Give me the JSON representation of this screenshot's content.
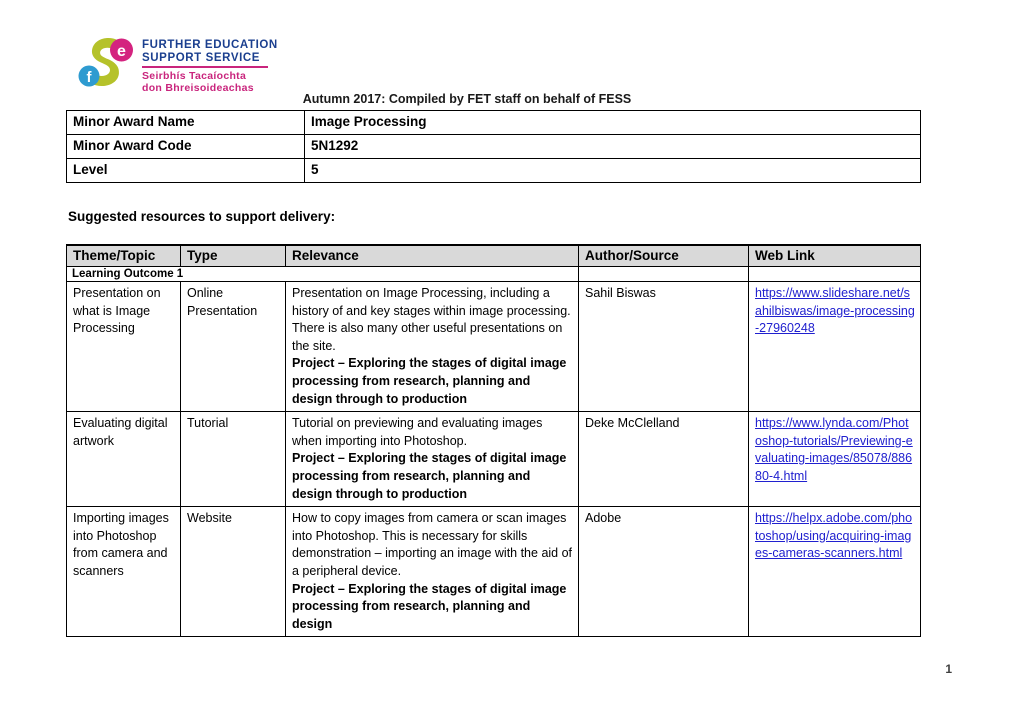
{
  "logo": {
    "alt": "Further Education Support Service",
    "line1": "FURTHER EDUCATION SUPPORT SERVICE",
    "line1_a": "FURTHER EDUCATION",
    "line1_b": "SUPPORT SERVICE",
    "line2_a": "Seirbhís Tacaíochta",
    "line2_b": "don Bhreisoideachas",
    "badge_e": "e",
    "badge_f": "f",
    "colors": {
      "swirl": "#b5c22a",
      "pink": "#d4237f",
      "blue": "#2e9bd0",
      "navy": "#1b3f8f"
    }
  },
  "header": {
    "text": "Autumn 2017: Compiled by FET staff on behalf of FESS"
  },
  "award": {
    "rows": [
      {
        "label": "Minor Award Name",
        "value": "Image Processing"
      },
      {
        "label": "Minor Award Code",
        "value": "5N1292"
      },
      {
        "label": "Level",
        "value": "5"
      }
    ]
  },
  "section": {
    "heading": "Suggested resources to support delivery:"
  },
  "resources": {
    "columns": [
      "Theme/Topic",
      "Type",
      "Relevance",
      "Author/Source",
      "Web Link"
    ],
    "group_label": "Learning Outcome 1",
    "rows": [
      {
        "theme": "Presentation on what is Image Processing",
        "type": "Online Presentation",
        "relevance": "Presentation on Image Processing, including a history of and key stages within image processing. There is also many other useful presentations on the site.",
        "relevance_bold": "Project – Exploring the stages of digital image processing from research, planning and design through to production",
        "author": "Sahil Biswas",
        "weblink": "https://www.slideshare.net/sahilbiswas/image-processing-27960248"
      },
      {
        "theme": "Evaluating digital artwork",
        "type": "Tutorial",
        "relevance": "Tutorial on previewing and evaluating images when importing into Photoshop.",
        "relevance_bold": "Project – Exploring the stages of digital image processing from research, planning and design through to production",
        "author": "Deke McClelland",
        "weblink": "https://www.lynda.com/Photoshop-tutorials/Previewing-evaluating-images/85078/88680-4.html"
      },
      {
        "theme": "Importing images into Photoshop from camera and scanners",
        "type": "Website",
        "relevance": "How to copy images from camera or scan images into Photoshop. This is necessary for skills demonstration – importing an image with the aid of a peripheral device.",
        "relevance_bold": "Project – Exploring the stages of digital image processing from research, planning and design",
        "author": "Adobe",
        "weblink": "https://helpx.adobe.com/photoshop/using/acquiring-images-cameras-scanners.html"
      }
    ]
  },
  "footer": {
    "page_number": "1"
  }
}
